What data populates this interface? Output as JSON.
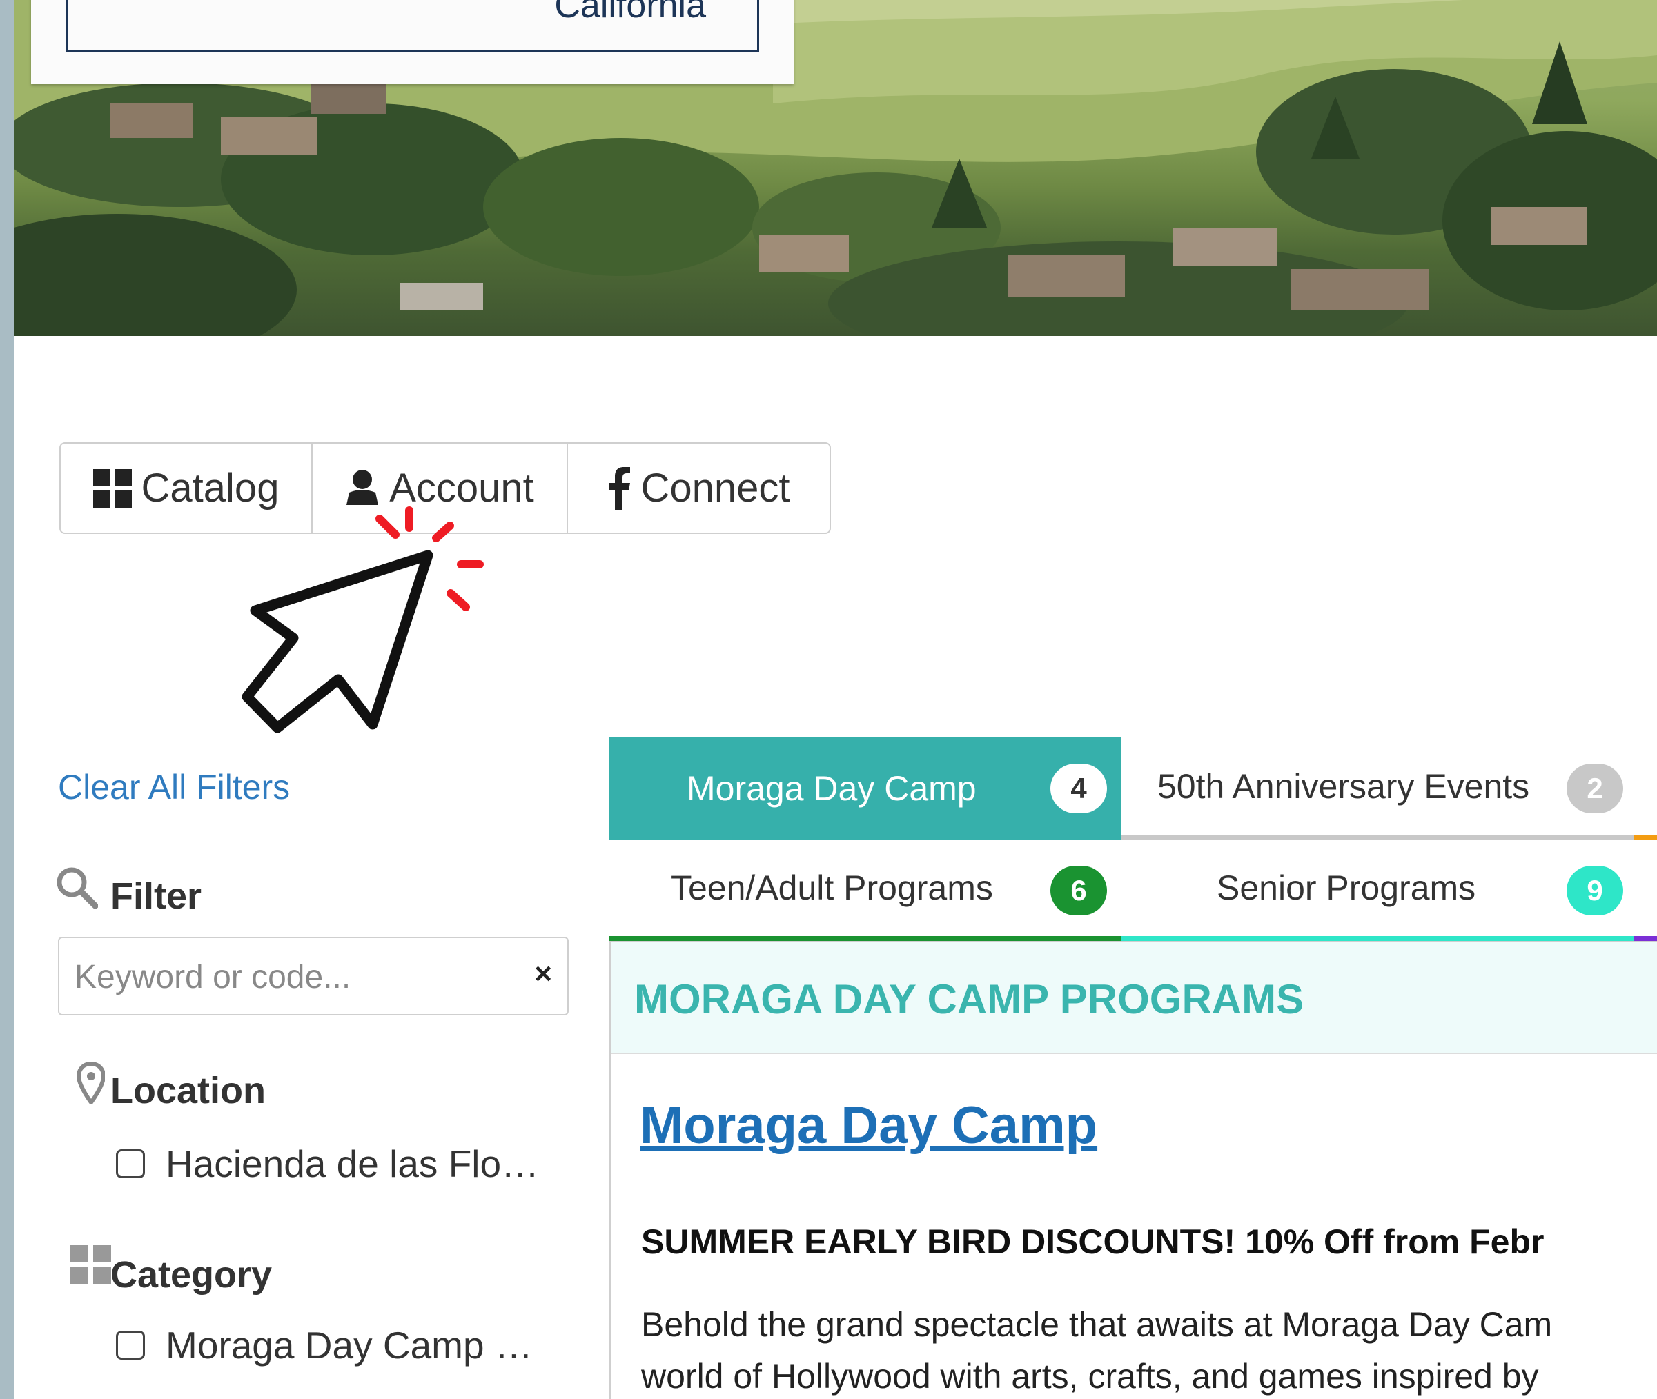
{
  "hero": {
    "title": "California"
  },
  "nav": {
    "catalog_label": "Catalog",
    "account_label": "Account",
    "connect_label": "Connect"
  },
  "sidebar": {
    "clear_filters": "Clear All Filters",
    "filter": {
      "title": "Filter",
      "search_placeholder": "Keyword or code...",
      "search_value": "",
      "clear_icon": "×"
    },
    "location": {
      "title": "Location",
      "options": [
        {
          "label": "Hacienda de las Flo…",
          "checked": false
        }
      ]
    },
    "category": {
      "title": "Category",
      "options": [
        {
          "label": "Moraga Day Camp …",
          "checked": false
        }
      ]
    }
  },
  "tabs": [
    {
      "label": "Moraga Day Camp",
      "count": "4",
      "active": true,
      "color": "#36b0ab"
    },
    {
      "label": "50th Anniversary Events",
      "count": "2",
      "active": false,
      "color": "#c8c8c8"
    },
    {
      "label": "Teen/Adult Programs",
      "count": "6",
      "active": false,
      "color": "#1a9331"
    },
    {
      "label": "Senior Programs",
      "count": "9",
      "active": false,
      "color": "#2ee6c8"
    }
  ],
  "program_section": {
    "title": "MORAGA DAY CAMP PROGRAMS",
    "program_link": "Moraga Day Camp",
    "promo": "SUMMER EARLY BIRD DISCOUNTS!  10% Off from Febr",
    "description": [
      "Behold the grand spectacle that awaits at Moraga Day Cam",
      "world of Hollywood with arts, crafts, and games inspired by"
    ]
  },
  "colors": {
    "accent_teal": "#36b0ab",
    "link_blue": "#1d6fb6",
    "click_burst": "#ee1c24",
    "tab_orange_edge": "#f39c12",
    "tab_purple_edge": "#7b2fd6"
  },
  "icons": {
    "catalog": "grid-icon",
    "account": "user-icon",
    "connect": "facebook-icon",
    "filter": "magnifier-icon",
    "location": "map-pin-icon",
    "category": "grid-icon",
    "cursor": "pointer-cursor-icon"
  }
}
